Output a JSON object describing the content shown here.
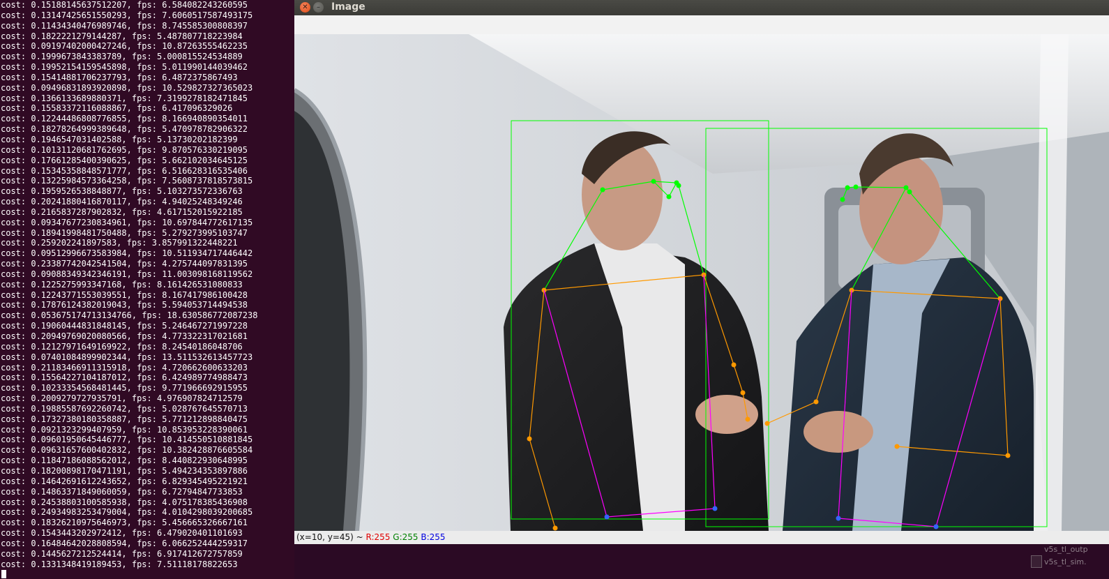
{
  "terminal": {
    "lines": [
      "cost: 0.15188145637512207, fps: 6.584082243260595",
      "cost: 0.13147425651550293, fps: 7.6060517587493175",
      "cost: 0.11434340476989746, fps: 8.745585300808397",
      "cost: 0.1822221279144287, fps: 5.487807718223984",
      "cost: 0.09197402000427246, fps: 10.87263555462235",
      "cost: 0.1999673843383789, fps: 5.000815524534889",
      "cost: 0.19952154159545898, fps: 5.011990144039462",
      "cost: 0.15414881706237793, fps: 6.4872375867493",
      "cost: 0.09496831893920898, fps: 10.529827327365023",
      "cost: 0.1366133689880371, fps: 7.3199278182471845",
      "cost: 0.15583372116088867, fps: 6.417096329026",
      "cost: 0.12244486808776855, fps: 8.166940890354011",
      "cost: 0.18278264999389648, fps: 5.470978782906322",
      "cost: 0.1946547031402588, fps: 5.13730202182399",
      "cost: 0.10131120681762695, fps: 9.870576330219095",
      "cost: 0.17661285400390625, fps: 5.662102034645125",
      "cost: 0.15345358848571777, fps: 6.516628316535406",
      "cost: 0.13225984573364258, fps: 7.5608737818573815",
      "cost: 0.1959526538848877, fps: 5.103273572336763",
      "cost: 0.20241880416870117, fps: 4.94025248349246",
      "cost: 0.2165837287902832, fps: 4.617152015922185",
      "cost: 0.09347677230834961, fps: 10.697844772617135",
      "cost: 0.18941998481750488, fps: 5.279273995103747",
      "cost: 0.259202241897583, fps: 3.857991322448221",
      "cost: 0.09512996673583984, fps: 10.511934717446442",
      "cost: 0.23387742042541504, fps: 4.275744097831395",
      "cost: 0.09088349342346191, fps: 11.003098168119562",
      "cost: 0.1225275993347168, fps: 8.161426531080833",
      "cost: 0.12243771553039551, fps: 8.167417986100428",
      "cost: 0.17876124382019043, fps: 5.594053714494538",
      "cost: 0.053675174713134766, fps: 18.630586772087238",
      "cost: 0.19060444831848145, fps: 5.246467271997228",
      "cost: 0.20949769020080566, fps: 4.773322317021681",
      "cost: 0.12127971649169922, fps: 8.24540186048706",
      "cost: 0.07401084899902344, fps: 13.511532613457723",
      "cost: 0.21183466911315918, fps: 4.720662600633203",
      "cost: 0.15564227104187012, fps: 6.424989774988473",
      "cost: 0.10233354568481445, fps: 9.771966692915955",
      "cost: 0.2009279727935791, fps: 4.976907824712579",
      "cost: 0.19885587692260742, fps: 5.028767645570713",
      "cost: 0.17327380180358887, fps: 5.771212898840475",
      "cost: 0.0921323299407959, fps: 10.853953228390061",
      "cost: 0.09601950645446777, fps: 10.414550510881845",
      "cost: 0.09631657600402832, fps: 10.382428876605584",
      "cost: 0.11847186088562012, fps: 8.440822930648995",
      "cost: 0.18200898170471191, fps: 5.494234353897886",
      "cost: 0.14642691612243652, fps: 6.829345495221921",
      "cost: 0.14863371849060059, fps: 6.72794847733853",
      "cost: 0.24538803100585938, fps: 4.075178385436908",
      "cost: 0.24934983253479004, fps: 4.0104298039200685",
      "cost: 0.18326210975646973, fps: 5.456665326667161",
      "cost: 0.1543443202972412, fps: 6.479020401101693",
      "cost: 0.16484642028808594, fps: 6.066252444259317",
      "cost: 0.1445627212524414, fps: 6.917412672757859",
      "cost: 0.1331348419189453, fps: 7.51118178822653"
    ]
  },
  "window": {
    "title": "Image",
    "close_icon": "close-icon",
    "minimize_icon": "minimize-icon"
  },
  "status": {
    "coords": "(x=10, y=45) ~ ",
    "r": "R:255",
    "g": "G:255",
    "b": "B:255"
  },
  "desktop": {
    "file1": "v5s_tl_outp",
    "file2": "v5s_tl_sim."
  },
  "overlay_colors": {
    "bbox": "#00ff00",
    "face": "#00ff00",
    "torso": "#ff9900",
    "side": "#ff00ff",
    "hip": "#3366ff"
  }
}
